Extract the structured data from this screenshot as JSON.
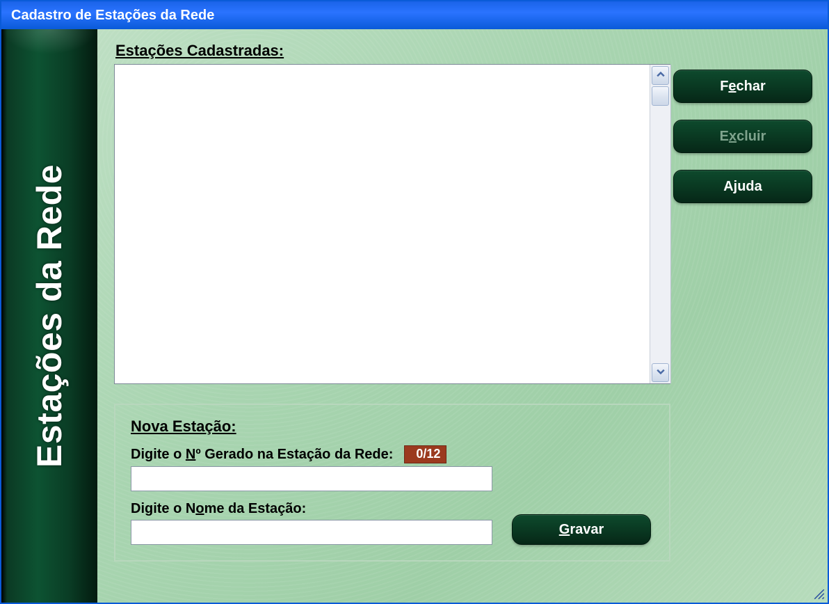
{
  "window": {
    "title": "Cadastro de Estações da Rede"
  },
  "sidebar": {
    "label": "Estações da Rede"
  },
  "list": {
    "title": "Estações Cadastradas:"
  },
  "buttons": {
    "close_pre": "F",
    "close_mn": "e",
    "close_post": "char",
    "delete_pre": "E",
    "delete_mn": "x",
    "delete_post": "cluir",
    "help": "Ajuda",
    "save_pre": "",
    "save_mn": "G",
    "save_post": "ravar"
  },
  "group": {
    "title": "Nova Estação:",
    "label_num_pre": "Digite o ",
    "label_num_mn": "N",
    "label_num_post": "º Gerado na Estação da Rede:",
    "counter": "0/12",
    "label_name_pre": "Digite o N",
    "label_name_mn": "o",
    "label_name_post": "me da Estação:"
  }
}
